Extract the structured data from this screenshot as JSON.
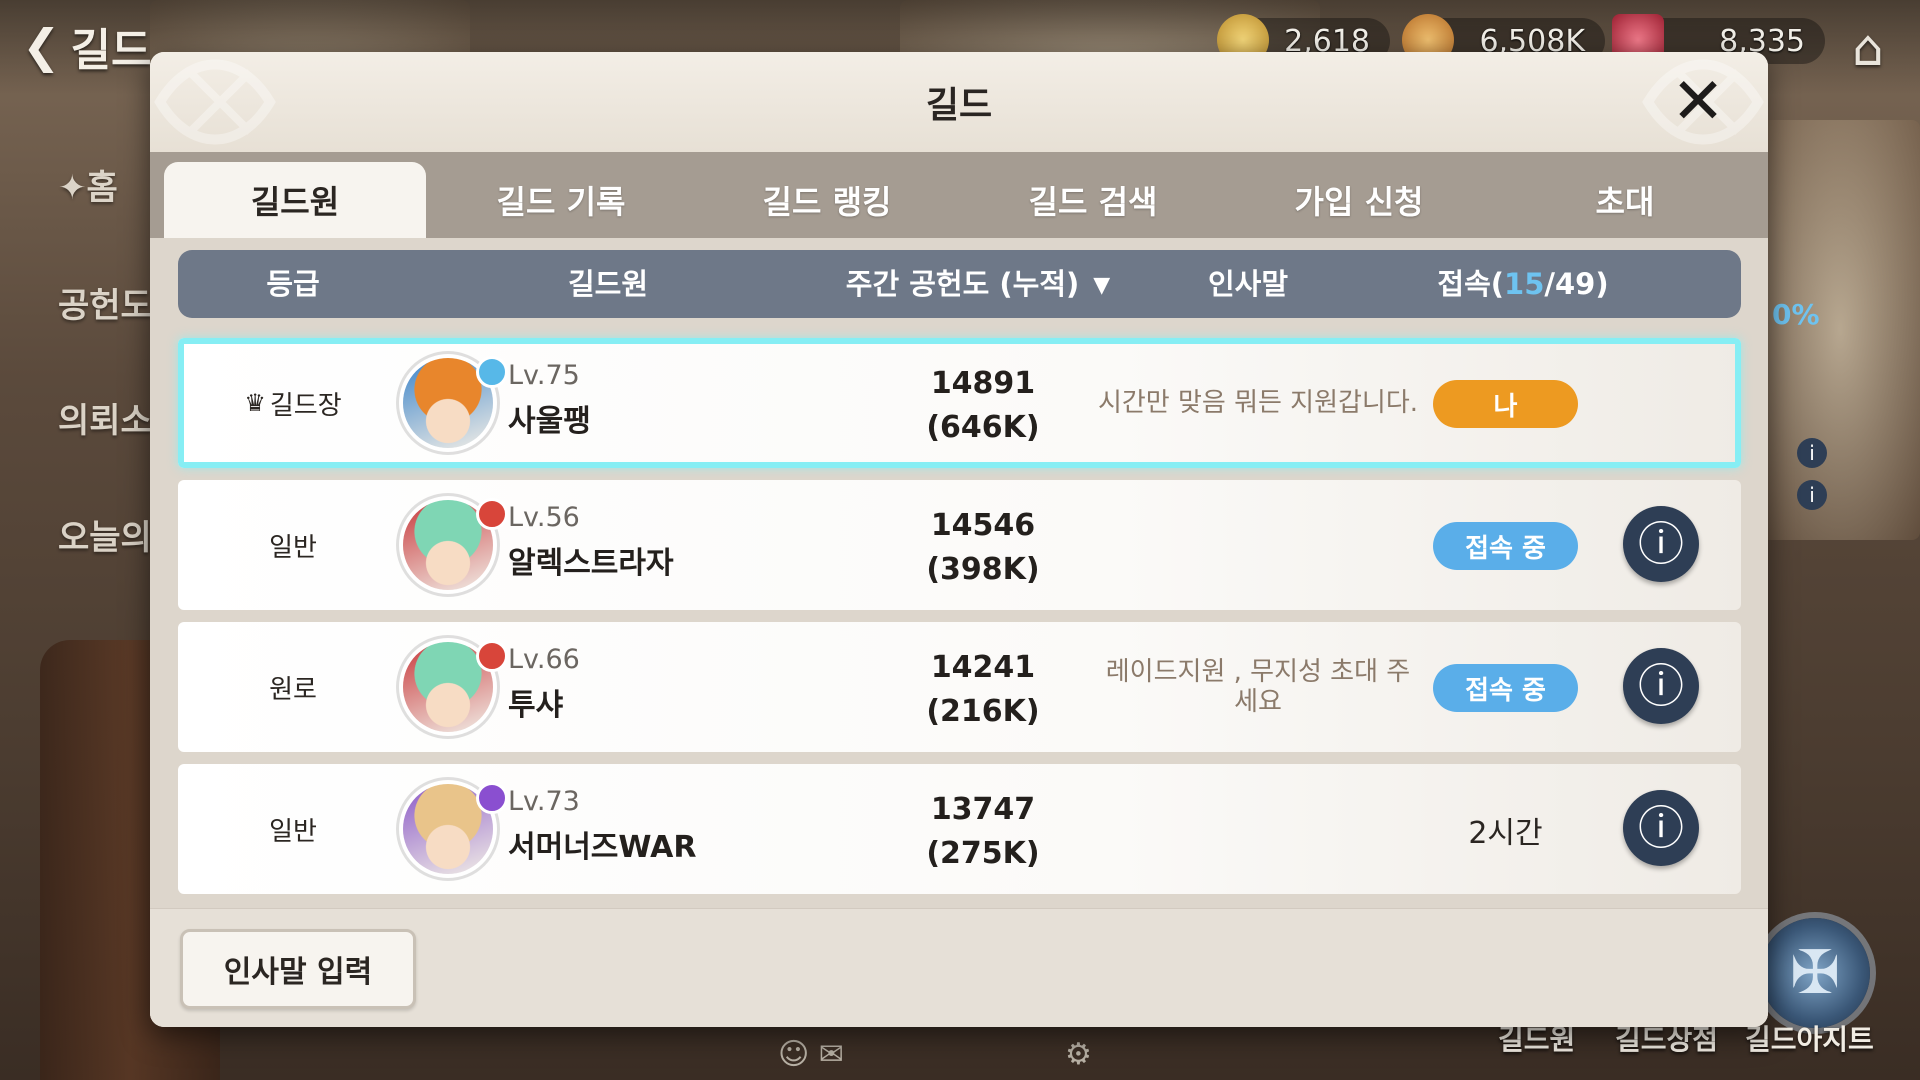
{
  "hud": {
    "back_label": "길드",
    "home_label": "Home",
    "currencies": [
      {
        "name": "gold-coin",
        "value": "2,618",
        "color": "#d9b04c"
      },
      {
        "name": "medal",
        "value": "6,508K",
        "color": "#d89a3a"
      },
      {
        "name": "gem",
        "value": "8,335",
        "color": "#c0394b"
      }
    ]
  },
  "left_menu": [
    "홈",
    "공헌도",
    "의뢰소",
    "오늘의"
  ],
  "bottom_nav": [
    "길드원",
    "길드상점",
    "길드아지트"
  ],
  "right_fragment": "0%",
  "modal": {
    "title": "길드",
    "tabs": [
      "길드원",
      "길드 기록",
      "길드 랭킹",
      "길드 검색",
      "가입 신청",
      "초대"
    ],
    "active_tab": 0,
    "columns": {
      "grade": "등급",
      "member": "길드원",
      "contribution": "주간 공헌도 (누적)",
      "greeting": "인사말",
      "online_prefix": "접속(",
      "online_count": "15",
      "online_sep": "/49)",
      "online_total": "49"
    },
    "members": [
      {
        "grade": "길드장",
        "level": "Lv.75",
        "name": "사울팽",
        "weekly": "14891",
        "total": "(646K)",
        "greeting": "시간만 맞음 뭐든 지원갑니다.",
        "status": "나",
        "status_type": "me",
        "avatar_hair": "#e8862c",
        "avatar_accent": "#3a83c9",
        "badge_color": "#57b8e8"
      },
      {
        "grade": "일반",
        "level": "Lv.56",
        "name": "알렉스트라자",
        "weekly": "14546",
        "total": "(398K)",
        "greeting": "",
        "status": "접속 중",
        "status_type": "online",
        "avatar_hair": "#7fd6b4",
        "avatar_accent": "#c8383b",
        "badge_color": "#d8453a"
      },
      {
        "grade": "원로",
        "level": "Lv.66",
        "name": "투샤",
        "weekly": "14241",
        "total": "(216K)",
        "greeting": "레이드지원 , 무지성 초대 주세요",
        "status": "접속 중",
        "status_type": "online",
        "avatar_hair": "#7fd6b4",
        "avatar_accent": "#c8383b",
        "badge_color": "#d8453a"
      },
      {
        "grade": "일반",
        "level": "Lv.73",
        "name": "서머너즈WAR",
        "weekly": "13747",
        "total": "(275K)",
        "greeting": "",
        "status": "2시간",
        "status_type": "time",
        "avatar_hair": "#e9c48a",
        "avatar_accent": "#8a58c8",
        "badge_color": "#8a4fd0"
      }
    ],
    "footer_button": "인사말 입력"
  }
}
